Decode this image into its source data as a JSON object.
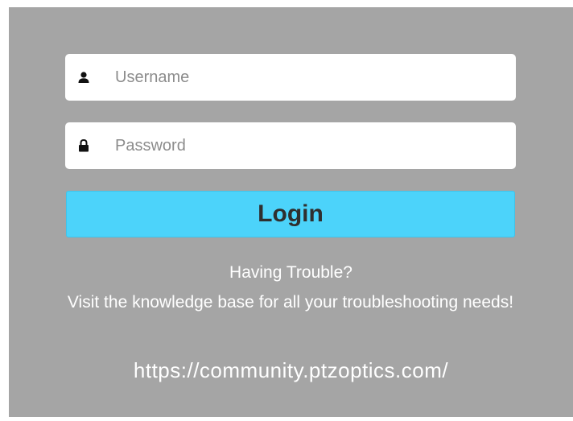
{
  "login_form": {
    "username": {
      "icon": "user-icon",
      "placeholder": "Username",
      "value": ""
    },
    "password": {
      "icon": "lock-icon",
      "placeholder": "Password",
      "value": ""
    },
    "login_label": "Login"
  },
  "help": {
    "title": "Having Trouble?",
    "text": "Visit the knowledge base for all your troubleshooting needs!",
    "link": "https://community.ptzoptics.com/"
  },
  "colors": {
    "background": "#a5a5a5",
    "button": "#4cd3fa",
    "field": "#ffffff",
    "help_text": "#ffffff"
  }
}
